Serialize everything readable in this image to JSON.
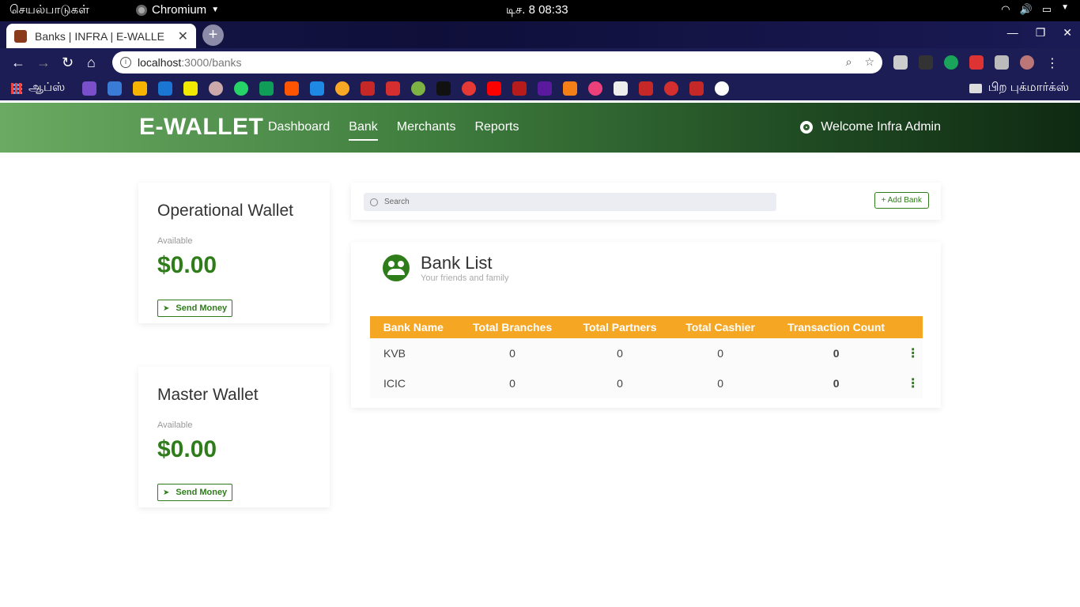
{
  "os": {
    "activities": "செயல்பாடுகள்",
    "app_name": "Chromium",
    "clock": "டிச. 8  08:33"
  },
  "browser": {
    "tab_title": "Banks | INFRA | E-WALLE",
    "url_host": "localhost",
    "url_path": ":3000/banks",
    "apps_label": "ஆப்ஸ்",
    "other_bookmarks": "பிற புக்மார்க்ஸ்"
  },
  "appnav": {
    "brand": "E-WALLET",
    "links": [
      "Dashboard",
      "Bank",
      "Merchants",
      "Reports"
    ],
    "active": "Bank",
    "welcome": "Welcome Infra Admin"
  },
  "wallets": [
    {
      "title": "Operational Wallet",
      "available_label": "Available",
      "amount": "$0.00",
      "action": "Send Money"
    },
    {
      "title": "Master Wallet",
      "available_label": "Available",
      "amount": "$0.00",
      "action": "Send Money"
    }
  ],
  "search": {
    "placeholder": "Search",
    "add_button": "+ Add Bank"
  },
  "bank_list": {
    "title": "Bank List",
    "subtitle": "Your friends and family",
    "columns": [
      "Bank Name",
      "Total Branches",
      "Total Partners",
      "Total Cashier",
      "Transaction Count"
    ],
    "rows": [
      {
        "name": "KVB",
        "branches": "0",
        "partners": "0",
        "cashier": "0",
        "transactions": "0"
      },
      {
        "name": "ICIC",
        "branches": "0",
        "partners": "0",
        "cashier": "0",
        "transactions": "0"
      }
    ]
  },
  "colors": {
    "accent": "#2e7d1a",
    "table_header": "#f5a623"
  }
}
